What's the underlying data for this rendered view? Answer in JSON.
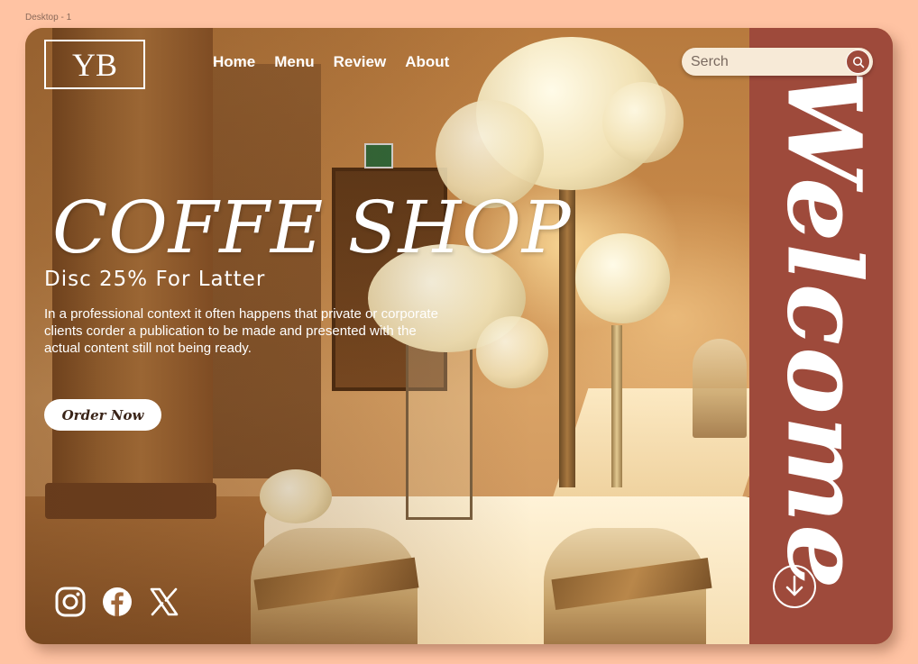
{
  "frame_label": "Desktop - 1",
  "logo": {
    "text": "YB"
  },
  "nav": {
    "items": [
      {
        "label": "Home"
      },
      {
        "label": "Menu"
      },
      {
        "label": "Review"
      },
      {
        "label": "About"
      }
    ]
  },
  "search": {
    "placeholder": "Serch",
    "icon": "search-icon"
  },
  "hero": {
    "title": "COFFE SHOP",
    "subtitle": "Disc 25% For Latter",
    "description": "In a professional context it often happens that private or corporate clients corder a publication to be made and presented with the actual content still not being ready.",
    "order_button": "Order Now"
  },
  "welcome": {
    "text": "Welcome",
    "scroll_icon": "arrow-down-circle-icon"
  },
  "social": [
    "instagram-icon",
    "facebook-icon",
    "x-icon"
  ],
  "colors": {
    "page_bg": "#ffc3a3",
    "panel": "#9e4a3b",
    "search_bg": "#f7ead7"
  }
}
